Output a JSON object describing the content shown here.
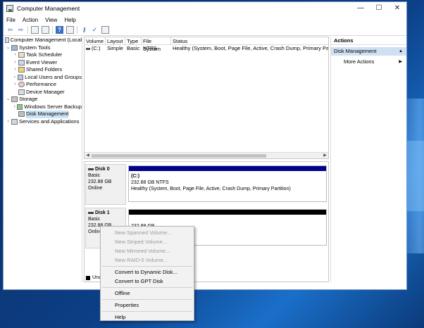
{
  "window": {
    "title": "Computer Management",
    "minimize": "—",
    "maximize": "☐",
    "close": "✕"
  },
  "menu": [
    "File",
    "Action",
    "View",
    "Help"
  ],
  "tree": {
    "root": "Computer Management (Local",
    "system_tools": "System Tools",
    "task_scheduler": "Task Scheduler",
    "event_viewer": "Event Viewer",
    "shared_folders": "Shared Folders",
    "local_users": "Local Users and Groups",
    "performance": "Performance",
    "device_manager": "Device Manager",
    "storage": "Storage",
    "windows_server_backup": "Windows Server Backup",
    "disk_management": "Disk Management",
    "services": "Services and Applications"
  },
  "volume_list": {
    "headers": [
      "Volume",
      "Layout",
      "Type",
      "File System",
      "Status"
    ],
    "rows": [
      {
        "volume": "(C:)",
        "layout": "Simple",
        "type": "Basic",
        "fs": "NTFS",
        "status": "Healthy (System, Boot, Page File, Active, Crash Dump, Primary Partition)"
      }
    ]
  },
  "disks": [
    {
      "name": "Disk 0",
      "type": "Basic",
      "size": "232.88 GB",
      "state": "Online",
      "partition_title": "(C:)",
      "partition_size": "232.88 GB NTFS",
      "partition_status": "Healthy (System, Boot, Page File, Active, Crash Dump, Primary Partition)",
      "bar_color": "#00008b"
    },
    {
      "name": "Disk 1",
      "type": "Basic",
      "size": "232.88 GB",
      "state": "Online",
      "partition_size": "232.88 GB",
      "bar_color": "#000000"
    }
  ],
  "legend": "Una",
  "actions": {
    "header": "Actions",
    "section": "Disk Management",
    "more": "More Actions"
  },
  "context_menu": {
    "new_spanned": "New Spanned Volume...",
    "new_striped": "New Striped Volume...",
    "new_mirrored": "New Mirrored Volume...",
    "new_raid5": "New RAID-5 Volume...",
    "convert_dynamic": "Convert to Dynamic Disk...",
    "convert_gpt": "Convert to GPT Disk",
    "offline": "Offline",
    "properties": "Properties",
    "help": "Help"
  }
}
